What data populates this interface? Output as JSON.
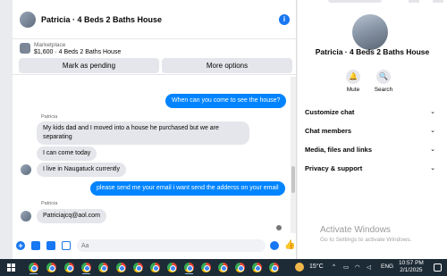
{
  "conversation": {
    "title": "Patricia · 4 Beds 2 Baths House",
    "info_icon": "i",
    "marketplace_label": "Marketplace",
    "listing": "$1,600 · 4 Beds 2 Baths House",
    "mark_pending_label": "Mark as pending",
    "more_options_label": "More options",
    "messages": {
      "m1": "When can you come to see the house?",
      "sender1": "Patricia",
      "m2": "My kids dad and I moved into a house he purchased but we are separating",
      "m3": "I can come today",
      "m4": "I live in Naugatuck currently",
      "m5": "please send me your email i want send the adderss on your email",
      "sender2": "Patricia",
      "m6": "Patriciajcq@aol.com"
    },
    "composer_placeholder": "Aa",
    "plus_icon": "+",
    "like_icon": "👍"
  },
  "details": {
    "title": "Patricia · 4 Beds 2 Baths House",
    "mute_label": "Mute",
    "search_label": "Search",
    "bell_icon": "🔔",
    "search_icon": "🔍",
    "sections": {
      "customize": "Customize chat",
      "members": "Chat members",
      "media": "Media, files and links",
      "privacy": "Privacy & support"
    },
    "chevron": "⌄"
  },
  "watermark": {
    "title": "Activate Windows",
    "subtitle": "Go to Settings to activate Windows."
  },
  "taskbar": {
    "weather_temp": "15°C",
    "tray_arrow": "^",
    "language": "ENG",
    "time": "10:57 PM",
    "date": "2/1/2025"
  },
  "colors": {
    "accent": "#1877f2",
    "outgoing_bubble": "#0084ff",
    "incoming_bubble": "#e4e6eb",
    "taskbar": "#1d2b36"
  }
}
